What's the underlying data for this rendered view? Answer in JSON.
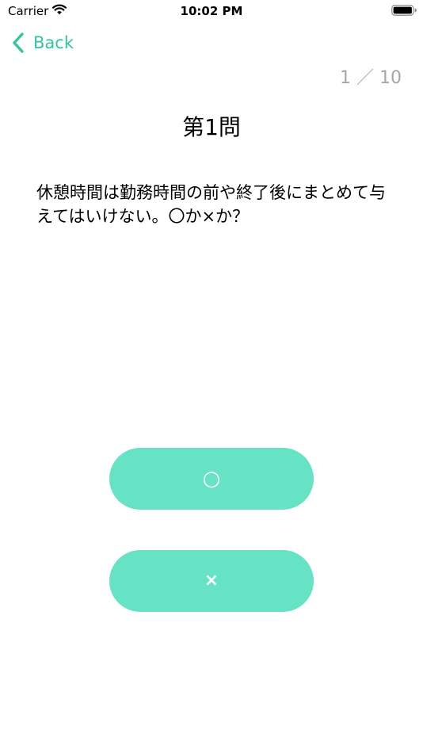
{
  "status_bar": {
    "carrier": "Carrier",
    "time": "10:02 PM",
    "wifi_icon": "wifi-icon",
    "battery_icon": "battery-icon"
  },
  "navigation": {
    "back_label": "Back",
    "back_icon": "chevron-left-icon"
  },
  "quiz": {
    "progress": "1 ／ 10",
    "title": "第1問",
    "question": "休憩時間は勤務時間の前や終了後にまとめて与えてはいけない。〇か×か？",
    "answers": [
      {
        "label": "○"
      },
      {
        "label": "×"
      }
    ]
  },
  "colors": {
    "accent": "#32c5a1",
    "button_background": "#66e2c4",
    "button_text": "#ffffff",
    "progress_text": "#a6a6a6"
  }
}
